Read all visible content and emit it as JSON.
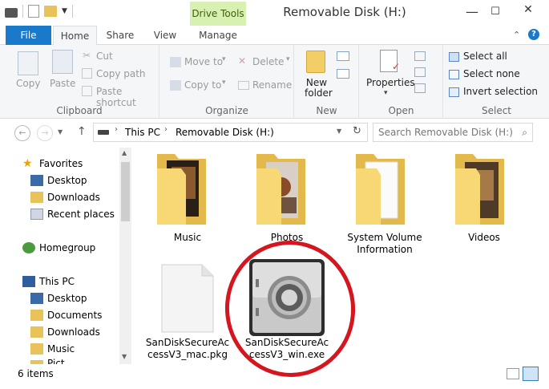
{
  "window": {
    "title": "Removable Disk (H:)",
    "context_tab": "Drive Tools"
  },
  "tabs": [
    "File",
    "Home",
    "Share",
    "View",
    "Manage"
  ],
  "ribbon": {
    "clipboard": {
      "label": "Clipboard",
      "copy": "Copy",
      "paste": "Paste",
      "cut": "Cut",
      "copy_path": "Copy path",
      "paste_shortcut": "Paste shortcut"
    },
    "organize": {
      "label": "Organize",
      "move_to": "Move to",
      "copy_to": "Copy to",
      "delete": "Delete",
      "rename": "Rename"
    },
    "new": {
      "label": "New",
      "new_folder": "New folder"
    },
    "open": {
      "label": "Open",
      "properties": "Properties"
    },
    "select": {
      "label": "Select",
      "select_all": "Select all",
      "select_none": "Select none",
      "invert": "Invert selection"
    }
  },
  "address": {
    "crumbs": [
      "This PC",
      "Removable Disk (H:)"
    ],
    "search_placeholder": "Search Removable Disk (H:)"
  },
  "nav": {
    "favorites": "Favorites",
    "fav_items": [
      "Desktop",
      "Downloads",
      "Recent places"
    ],
    "homegroup": "Homegroup",
    "this_pc": "This PC",
    "pc_items": [
      "Desktop",
      "Documents",
      "Downloads",
      "Music",
      "Pict"
    ]
  },
  "files": [
    {
      "name": "Music",
      "type": "folder"
    },
    {
      "name": "Photos",
      "type": "folder"
    },
    {
      "name": "System Volume Information",
      "type": "folder"
    },
    {
      "name": "Videos",
      "type": "folder"
    },
    {
      "name": "SanDiskSecureAccessV3_mac.pkg",
      "line1": "SanDiskSecureAc",
      "line2": "cessV3_mac.pkg",
      "type": "file"
    },
    {
      "name": "SanDiskSecureAccessV3_win.exe",
      "line1": "SanDiskSecureAc",
      "line2": "cessV3_win.exe",
      "type": "exe"
    }
  ],
  "status": {
    "count": "6 items"
  },
  "colors": {
    "file_tab": "#1979ca",
    "context_tab": "#d9f0b3",
    "highlight_ring": "#d5161f",
    "folder": "#f8d775"
  }
}
